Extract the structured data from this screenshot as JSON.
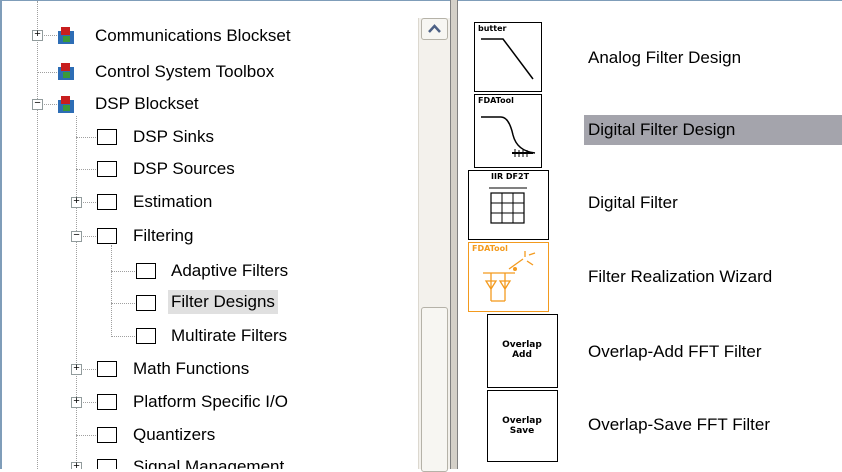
{
  "tree": {
    "items": [
      {
        "label": "Communications Blockset",
        "expander": "+"
      },
      {
        "label": "Control System Toolbox",
        "expander": ""
      },
      {
        "label": "DSP Blockset",
        "expander": "−"
      },
      {
        "label": "DSP Sinks",
        "expander": ""
      },
      {
        "label": "DSP Sources",
        "expander": ""
      },
      {
        "label": "Estimation",
        "expander": "+"
      },
      {
        "label": "Filtering",
        "expander": "−"
      },
      {
        "label": "Adaptive Filters",
        "expander": ""
      },
      {
        "label": "Filter Designs",
        "expander": "",
        "selected": true
      },
      {
        "label": "Multirate Filters",
        "expander": ""
      },
      {
        "label": "Math Functions",
        "expander": "+"
      },
      {
        "label": "Platform Specific I/O",
        "expander": "+"
      },
      {
        "label": "Quantizers",
        "expander": ""
      },
      {
        "label": "Signal Management",
        "expander": "+"
      }
    ]
  },
  "scrollbar": {
    "up_arrow_icon": "chevron-up-icon"
  },
  "blocks": {
    "items": [
      {
        "caption": "butter",
        "label": "Analog Filter Design"
      },
      {
        "caption": "FDATool",
        "label": "Digital Filter Design",
        "selected": true
      },
      {
        "caption": "IIR DF2T",
        "label": "Digital Filter"
      },
      {
        "caption": "FDATool",
        "label": "Filter Realization Wizard"
      },
      {
        "caption": "Overlap Add",
        "label": "Overlap-Add FFT Filter"
      },
      {
        "caption": "Overlap Save",
        "label": "Overlap-Save FFT Filter"
      }
    ]
  },
  "colors": {
    "selection_tree": "#e0e0e0",
    "selection_block": "#a4a4ac",
    "wizard_orange": "#f39a1e",
    "border_blue": "#7f9db9"
  }
}
